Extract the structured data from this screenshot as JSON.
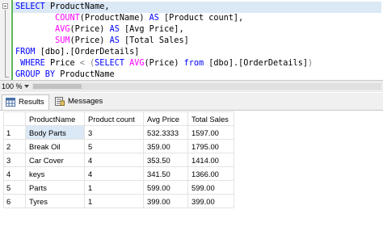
{
  "editor": {
    "lines": [
      {
        "kw1": "SELECT",
        "t1": " ProductName,"
      },
      {
        "pad": "        ",
        "fn": "COUNT",
        "t1": "(ProductName) ",
        "kw": "AS",
        "t2": " [Product count],"
      },
      {
        "pad": "        ",
        "fn": "AVG",
        "t1": "(Price) ",
        "kw": "AS",
        "t2": " [Avg Price],"
      },
      {
        "pad": "        ",
        "fn": "SUM",
        "t1": "(Price) ",
        "kw": "AS",
        "t2": " [Total Sales]"
      },
      {
        "kw1": "FROM",
        "t1": " [dbo].[OrderDetails]"
      },
      {
        "kw1": " WHERE",
        "t1": " Price ",
        "op1": "<",
        "t2": " ",
        "op2": "(",
        "kw2": "SELECT",
        "t3": " ",
        "fn": "AVG",
        "t4": "(Price) ",
        "kw3": "from",
        "t5": " [dbo].[OrderDetails]",
        "op3": ")"
      },
      {
        "kw1": "GROUP BY",
        "t1": " ProductName"
      }
    ]
  },
  "zoom": {
    "value": "100 %"
  },
  "tabs": {
    "results": "Results",
    "messages": "Messages"
  },
  "grid": {
    "headers": [
      "ProductName",
      "Product count",
      "Avg Price",
      "Total Sales"
    ],
    "rows": [
      {
        "n": "1",
        "cells": [
          "Body Parts",
          "3",
          "532.3333",
          "1597.00"
        ]
      },
      {
        "n": "2",
        "cells": [
          "Break Oil",
          "5",
          "359.00",
          "1795.00"
        ]
      },
      {
        "n": "3",
        "cells": [
          "Car Cover",
          "4",
          "353.50",
          "1414.00"
        ]
      },
      {
        "n": "4",
        "cells": [
          "keys",
          "4",
          "341.50",
          "1366.00"
        ]
      },
      {
        "n": "5",
        "cells": [
          "Parts",
          "1",
          "599.00",
          "599.00"
        ]
      },
      {
        "n": "6",
        "cells": [
          "Tyres",
          "1",
          "399.00",
          "399.00"
        ]
      }
    ]
  },
  "colors": {
    "keyword": "#0000ff",
    "function": "#ff00ff",
    "operator": "#808080",
    "selection": "#dbe8f6",
    "change_bar": "#58b558"
  }
}
